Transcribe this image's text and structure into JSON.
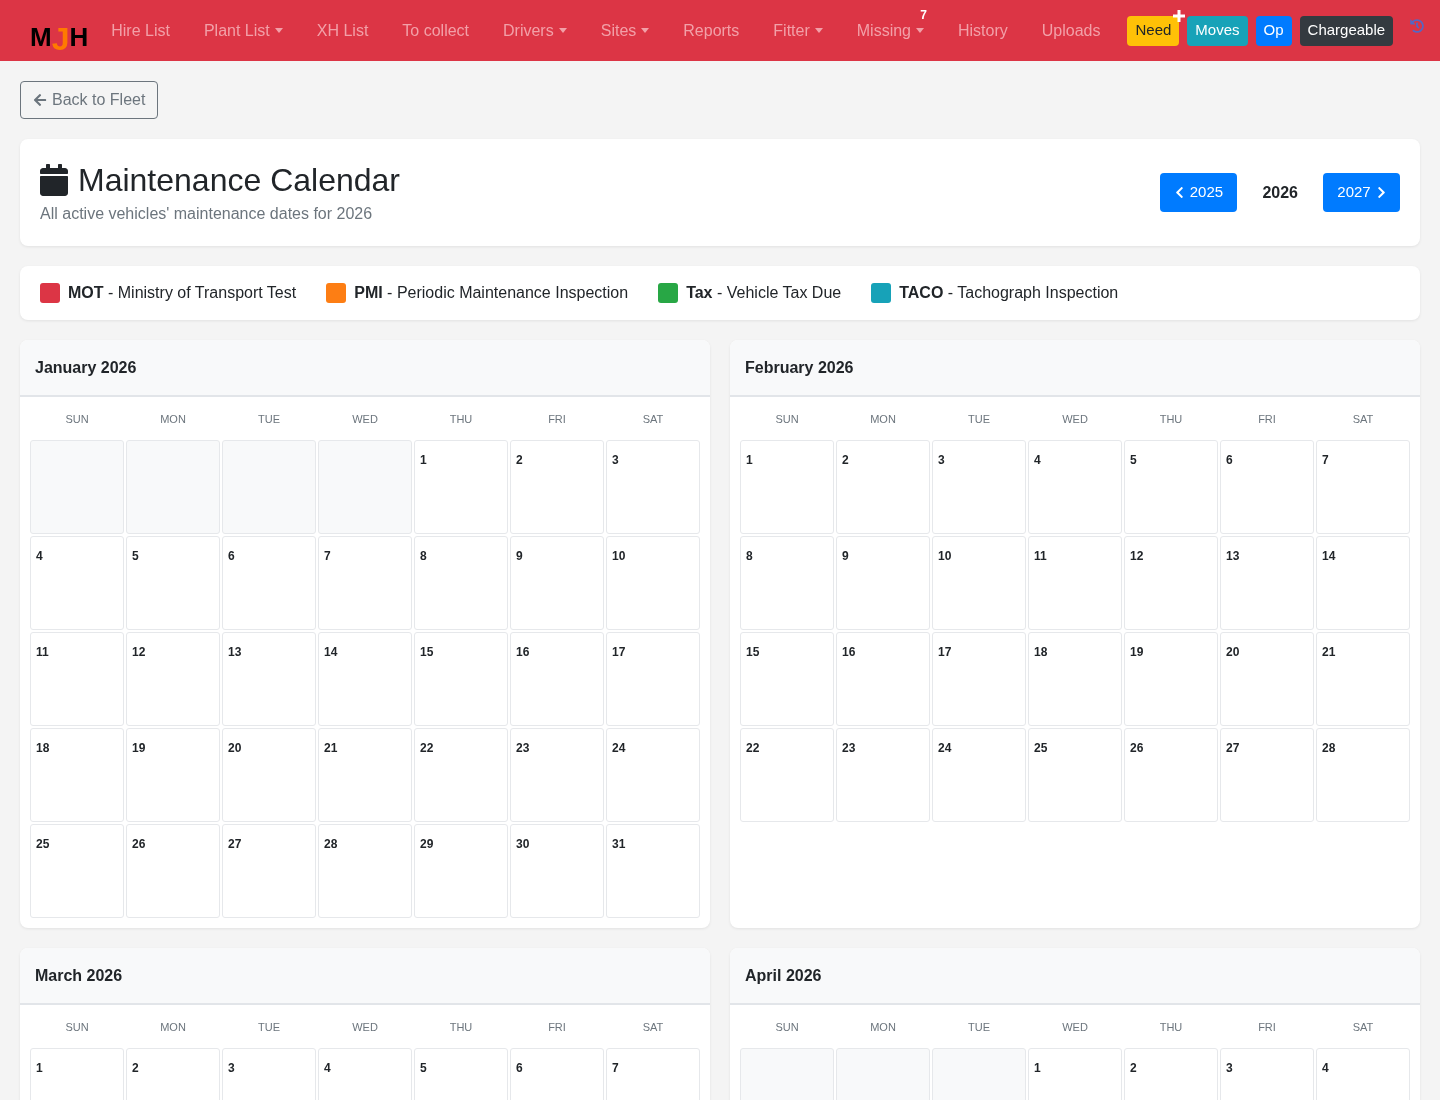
{
  "navbar": {
    "logo": "MJH",
    "items": [
      {
        "label": "Hire List",
        "dropdown": false
      },
      {
        "label": "Plant List",
        "dropdown": true
      },
      {
        "label": "XH List",
        "dropdown": false
      },
      {
        "label": "To collect",
        "dropdown": false
      },
      {
        "label": "Drivers",
        "dropdown": true
      },
      {
        "label": "Sites",
        "dropdown": true
      },
      {
        "label": "Reports",
        "dropdown": false
      },
      {
        "label": "Fitter",
        "dropdown": true
      },
      {
        "label": "Missing",
        "dropdown": true,
        "badge": "7"
      },
      {
        "label": "History",
        "dropdown": false
      },
      {
        "label": "Uploads",
        "dropdown": false
      }
    ],
    "buttons": [
      {
        "label": "Need",
        "kind": "warning",
        "plus": true
      },
      {
        "label": "Moves",
        "kind": "info",
        "plus": false
      },
      {
        "label": "Op",
        "kind": "primary",
        "plus": false
      },
      {
        "label": "Chargeable",
        "kind": "dark",
        "plus": false
      }
    ]
  },
  "back_button": {
    "label": "Back to Fleet"
  },
  "header": {
    "title": "Maintenance Calendar",
    "subtitle": "All active vehicles' maintenance dates for 2026",
    "previous_year": "2025",
    "current_year": "2026",
    "next_year": "2027"
  },
  "legend": {
    "items": [
      {
        "text": "**MOT** - Ministry of Transport Test",
        "color": "#dc3545"
      },
      {
        "text": "**PMI** - Periodic Maintenance Inspection",
        "color": "#fd7e14"
      },
      {
        "text": "**Tax** - Vehicle Tax Due",
        "color": "#28a745"
      },
      {
        "text": "**TACO** - Tachograph Inspection",
        "color": "#17a2b8"
      }
    ]
  },
  "months": [
    {
      "title": "January 2026",
      "weekdays": [
        "SUN",
        "MON",
        "TUE",
        "WED",
        "THU",
        "FRI",
        "SAT"
      ],
      "weeks": [
        [
          {
            "kind": "blank"
          },
          {
            "kind": "blank"
          },
          {
            "kind": "blank"
          },
          {
            "kind": "blank"
          },
          {
            "kind": "day",
            "day": "1"
          },
          {
            "kind": "day",
            "day": "2"
          },
          {
            "kind": "day",
            "day": "3"
          }
        ],
        [
          {
            "kind": "day",
            "day": "4"
          },
          {
            "kind": "day",
            "day": "5"
          },
          {
            "kind": "day",
            "day": "6"
          },
          {
            "kind": "day",
            "day": "7"
          },
          {
            "kind": "day",
            "day": "8"
          },
          {
            "kind": "day",
            "day": "9"
          },
          {
            "kind": "day",
            "day": "10"
          }
        ],
        [
          {
            "kind": "day",
            "day": "11"
          },
          {
            "kind": "day",
            "day": "12"
          },
          {
            "kind": "day",
            "day": "13"
          },
          {
            "kind": "day",
            "day": "14"
          },
          {
            "kind": "day",
            "day": "15"
          },
          {
            "kind": "day",
            "day": "16"
          },
          {
            "kind": "day",
            "day": "17"
          }
        ],
        [
          {
            "kind": "day",
            "day": "18"
          },
          {
            "kind": "day",
            "day": "19"
          },
          {
            "kind": "day",
            "day": "20"
          },
          {
            "kind": "day",
            "day": "21"
          },
          {
            "kind": "day",
            "day": "22"
          },
          {
            "kind": "day",
            "day": "23"
          },
          {
            "kind": "day",
            "day": "24"
          }
        ],
        [
          {
            "kind": "day",
            "day": "25"
          },
          {
            "kind": "day",
            "day": "26"
          },
          {
            "kind": "day",
            "day": "27"
          },
          {
            "kind": "day",
            "day": "28"
          },
          {
            "kind": "day",
            "day": "29"
          },
          {
            "kind": "day",
            "day": "30"
          },
          {
            "kind": "day",
            "day": "31"
          }
        ]
      ]
    },
    {
      "title": "February 2026",
      "weekdays": [
        "SUN",
        "MON",
        "TUE",
        "WED",
        "THU",
        "FRI",
        "SAT"
      ],
      "weeks": [
        [
          {
            "kind": "day",
            "day": "1"
          },
          {
            "kind": "day",
            "day": "2"
          },
          {
            "kind": "day",
            "day": "3"
          },
          {
            "kind": "day",
            "day": "4"
          },
          {
            "kind": "day",
            "day": "5"
          },
          {
            "kind": "day",
            "day": "6"
          },
          {
            "kind": "day",
            "day": "7"
          }
        ],
        [
          {
            "kind": "day",
            "day": "8"
          },
          {
            "kind": "day",
            "day": "9"
          },
          {
            "kind": "day",
            "day": "10"
          },
          {
            "kind": "day",
            "day": "11"
          },
          {
            "kind": "day",
            "day": "12"
          },
          {
            "kind": "day",
            "day": "13"
          },
          {
            "kind": "day",
            "day": "14"
          }
        ],
        [
          {
            "kind": "day",
            "day": "15"
          },
          {
            "kind": "day",
            "day": "16"
          },
          {
            "kind": "day",
            "day": "17"
          },
          {
            "kind": "day",
            "day": "18"
          },
          {
            "kind": "day",
            "day": "19"
          },
          {
            "kind": "day",
            "day": "20"
          },
          {
            "kind": "day",
            "day": "21"
          }
        ],
        [
          {
            "kind": "day",
            "day": "22"
          },
          {
            "kind": "day",
            "day": "23"
          },
          {
            "kind": "day",
            "day": "24"
          },
          {
            "kind": "day",
            "day": "25"
          },
          {
            "kind": "day",
            "day": "26"
          },
          {
            "kind": "day",
            "day": "27"
          },
          {
            "kind": "day",
            "day": "28"
          }
        ]
      ]
    },
    {
      "title": "March 2026",
      "weekdays": [
        "SUN",
        "MON",
        "TUE",
        "WED",
        "THU",
        "FRI",
        "SAT"
      ],
      "weeks": [
        [
          {
            "kind": "day",
            "day": "1"
          },
          {
            "kind": "day",
            "day": "2"
          },
          {
            "kind": "day",
            "day": "3"
          },
          {
            "kind": "day",
            "day": "4"
          },
          {
            "kind": "day",
            "day": "5"
          },
          {
            "kind": "day",
            "day": "6"
          },
          {
            "kind": "day",
            "day": "7"
          }
        ]
      ]
    },
    {
      "title": "April 2026",
      "weekdays": [
        "SUN",
        "MON",
        "TUE",
        "WED",
        "THU",
        "FRI",
        "SAT"
      ],
      "weeks": [
        [
          {
            "kind": "blank"
          },
          {
            "kind": "blank"
          },
          {
            "kind": "blank"
          },
          {
            "kind": "day",
            "day": "1"
          },
          {
            "kind": "day",
            "day": "2"
          },
          {
            "kind": "day",
            "day": "3"
          },
          {
            "kind": "day",
            "day": "4"
          }
        ]
      ]
    }
  ]
}
